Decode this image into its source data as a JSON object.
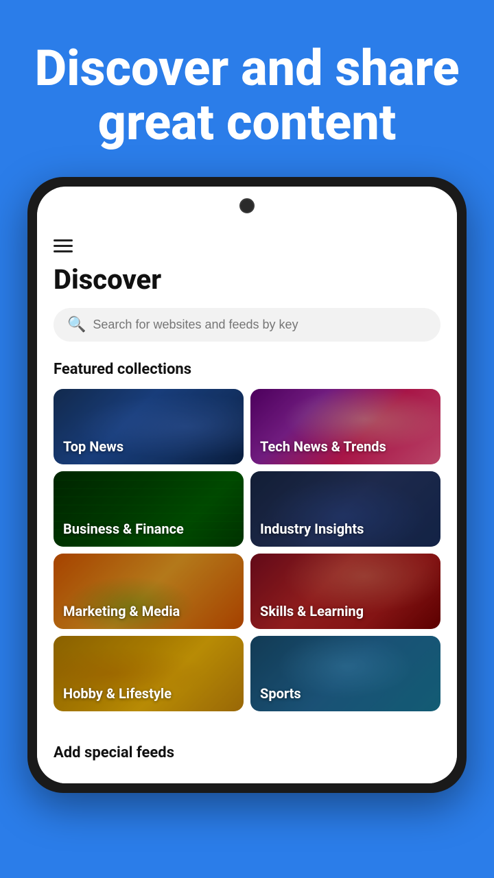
{
  "hero": {
    "title": "Discover and share great content"
  },
  "app": {
    "page_title": "Discover",
    "search": {
      "placeholder": "Search for websites and feeds by key"
    },
    "featured_section_title": "Featured collections",
    "add_feeds_section_title": "Add special feeds",
    "collections": [
      {
        "id": "top-news",
        "label": "Top News",
        "css_class": "card-top-news"
      },
      {
        "id": "tech-news",
        "label": "Tech News & Trends",
        "css_class": "card-tech-news"
      },
      {
        "id": "business",
        "label": "Business & Finance",
        "css_class": "card-business"
      },
      {
        "id": "industry",
        "label": "Industry Insights",
        "css_class": "card-industry"
      },
      {
        "id": "marketing",
        "label": "Marketing & Media",
        "css_class": "card-marketing"
      },
      {
        "id": "skills",
        "label": "Skills & Learning",
        "css_class": "card-skills"
      },
      {
        "id": "hobby",
        "label": "Hobby & Lifestyle",
        "css_class": "card-hobby"
      },
      {
        "id": "sports",
        "label": "Sports",
        "css_class": "card-sports"
      }
    ]
  }
}
